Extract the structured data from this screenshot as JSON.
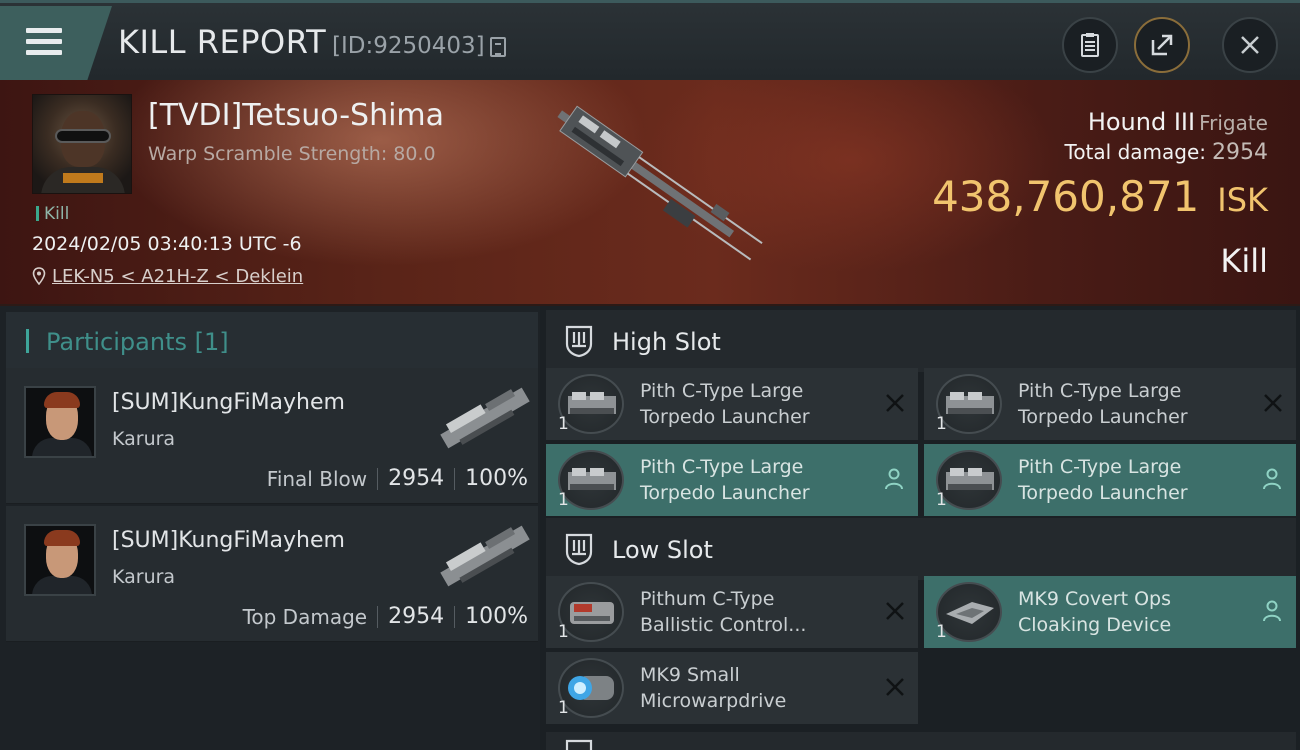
{
  "header": {
    "title": "KILL REPORT",
    "report_id": "[ID:9250403]",
    "icons": {
      "menu": "menu-icon",
      "copy": "copy-icon",
      "clipboard": "clipboard-icon",
      "share": "share-icon",
      "close": "close-icon"
    }
  },
  "victim": {
    "name": "[TVDI]Tetsuo-Shima",
    "stat_line": "Warp Scramble Strength: 80.0",
    "kill_tag": "Kill",
    "datetime": "2024/02/05 03:40:13 UTC -6",
    "location": "LEK-N5 < A21H-Z < Deklein",
    "ship": "Hound III",
    "ship_class": "Frigate",
    "total_damage_label": "Total damage:",
    "total_damage": "2954",
    "isk_value": "438,760,871",
    "isk_unit": "ISK",
    "result": "Kill"
  },
  "participants": {
    "title": "Participants [1]",
    "rows": [
      {
        "name": "[SUM]KungFiMayhem",
        "ship": "Karura",
        "role": "Final Blow",
        "damage": "2954",
        "percent": "100%"
      },
      {
        "name": "[SUM]KungFiMayhem",
        "ship": "Karura",
        "role": "Top Damage",
        "damage": "2954",
        "percent": "100%"
      }
    ]
  },
  "fitting": {
    "high_slot": {
      "title": "High Slot",
      "modules": [
        {
          "line1": "Pith C-Type Large",
          "line2": "Torpedo Launcher",
          "qty": "1",
          "state": "destroyed"
        },
        {
          "line1": "Pith C-Type Large",
          "line2": "Torpedo Launcher",
          "qty": "1",
          "state": "destroyed"
        },
        {
          "line1": "Pith C-Type Large",
          "line2": "Torpedo Launcher",
          "qty": "1",
          "state": "dropped"
        },
        {
          "line1": "Pith C-Type Large",
          "line2": "Torpedo Launcher",
          "qty": "1",
          "state": "dropped"
        }
      ]
    },
    "low_slot": {
      "title": "Low Slot",
      "modules": [
        {
          "line1": "Pithum C-Type",
          "line2": "Ballistic Control...",
          "qty": "1",
          "state": "destroyed"
        },
        {
          "line1": "MK9 Covert Ops",
          "line2": "Cloaking Device",
          "qty": "1",
          "state": "dropped"
        },
        {
          "line1": "MK9 Small",
          "line2": "Microwarpdrive",
          "qty": "1",
          "state": "destroyed"
        }
      ]
    }
  },
  "colors": {
    "accent": "#3ea59a",
    "isk": "#f1c46e",
    "highlight_row": "#3d6f6a"
  }
}
